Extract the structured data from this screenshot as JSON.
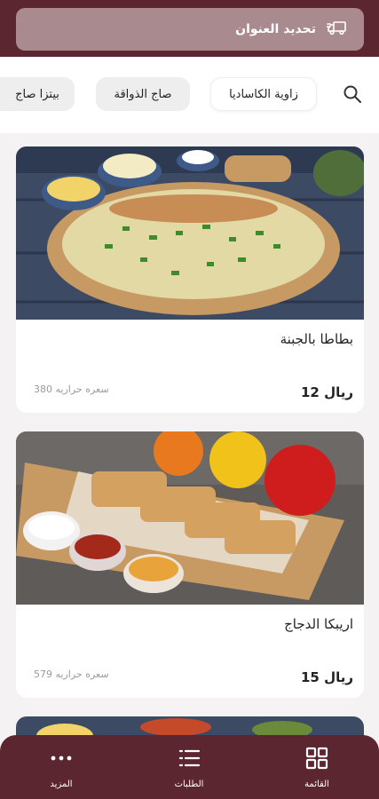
{
  "header": {
    "address_button_label": "تحديد العنوان",
    "delivery_icon": "delivery-truck-icon"
  },
  "categories": {
    "search_icon": "search-icon",
    "items": [
      {
        "label": "زاوية الكاساديا",
        "active": true
      },
      {
        "label": "صاج الذواقة",
        "active": false
      },
      {
        "label": "بيتزا صاج",
        "active": false
      }
    ]
  },
  "products": [
    {
      "title": "بطاطا بالجبنة",
      "price": "12 ريال",
      "calories": "380 سعره حراريه"
    },
    {
      "title": "اريبكا الدجاج",
      "price": "15 ريال",
      "calories": "579 سعره حراريه"
    }
  ],
  "bottom_nav": {
    "items": [
      {
        "label": "القائمة",
        "icon": "grid-icon"
      },
      {
        "label": "الطلبات",
        "icon": "list-icon"
      },
      {
        "label": "المزيد",
        "icon": "more-dots-icon"
      }
    ]
  },
  "colors": {
    "brand": "#5b2630",
    "address_bar": "#a98a8f",
    "background": "#f4f2f2"
  }
}
